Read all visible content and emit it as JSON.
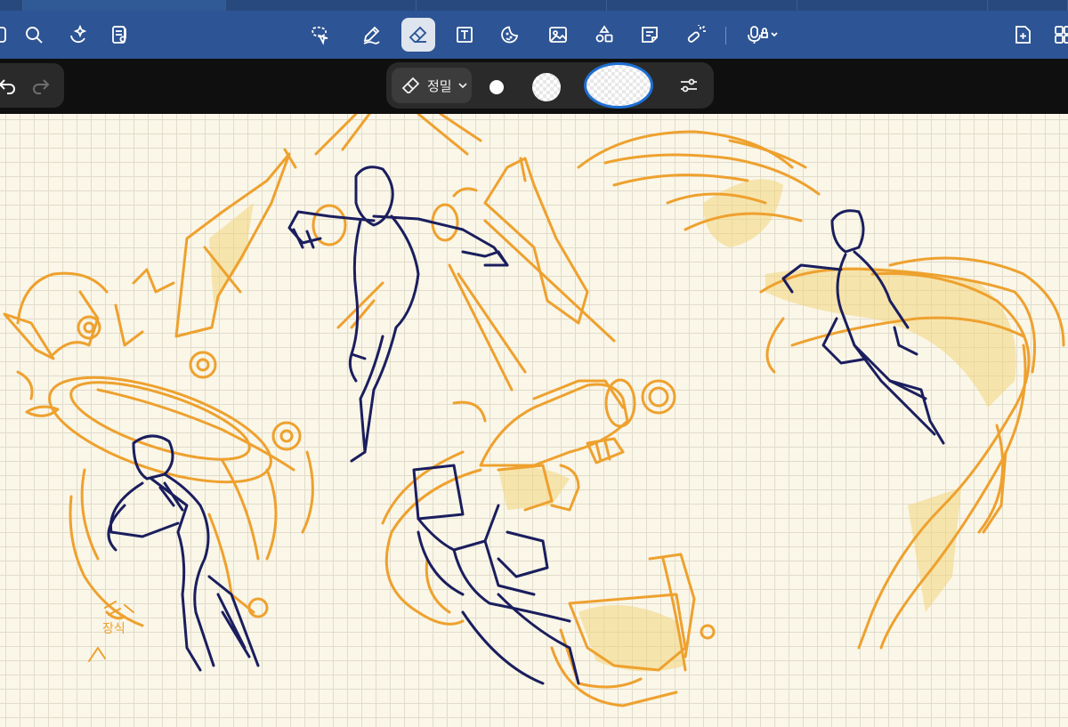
{
  "tabs": [
    {
      "label": "",
      "active": false
    },
    {
      "label": "",
      "active": true
    },
    {
      "label": "",
      "active": false
    },
    {
      "label": "",
      "active": false
    },
    {
      "label": "",
      "active": false
    },
    {
      "label": "",
      "active": false
    },
    {
      "label": "",
      "active": false
    }
  ],
  "toolbar": {
    "left_icons": [
      "sidebar-icon",
      "search-icon",
      "ai-sparkle-icon",
      "document-settings-icon"
    ],
    "center_icons": [
      "lasso-icon",
      "pen-icon",
      "eraser-icon",
      "text-box-icon",
      "sticker-icon",
      "image-icon",
      "shapes-icon",
      "note-icon",
      "laser-pointer-icon"
    ],
    "selected_tool": "eraser-icon",
    "right_icons": [
      "record-audio-icon",
      "add-page-icon",
      "more-icon"
    ]
  },
  "eraser_settings": {
    "mode_label": "정밀",
    "sizes": [
      "small",
      "medium",
      "large"
    ],
    "selected_size": "large"
  },
  "canvas": {
    "signature": "장식",
    "colors": {
      "orange": "#eea12e",
      "navy": "#1a1e5e",
      "highlight": "#f3d67c",
      "grid": "#e1dccb",
      "paper": "#faf6e8"
    }
  }
}
